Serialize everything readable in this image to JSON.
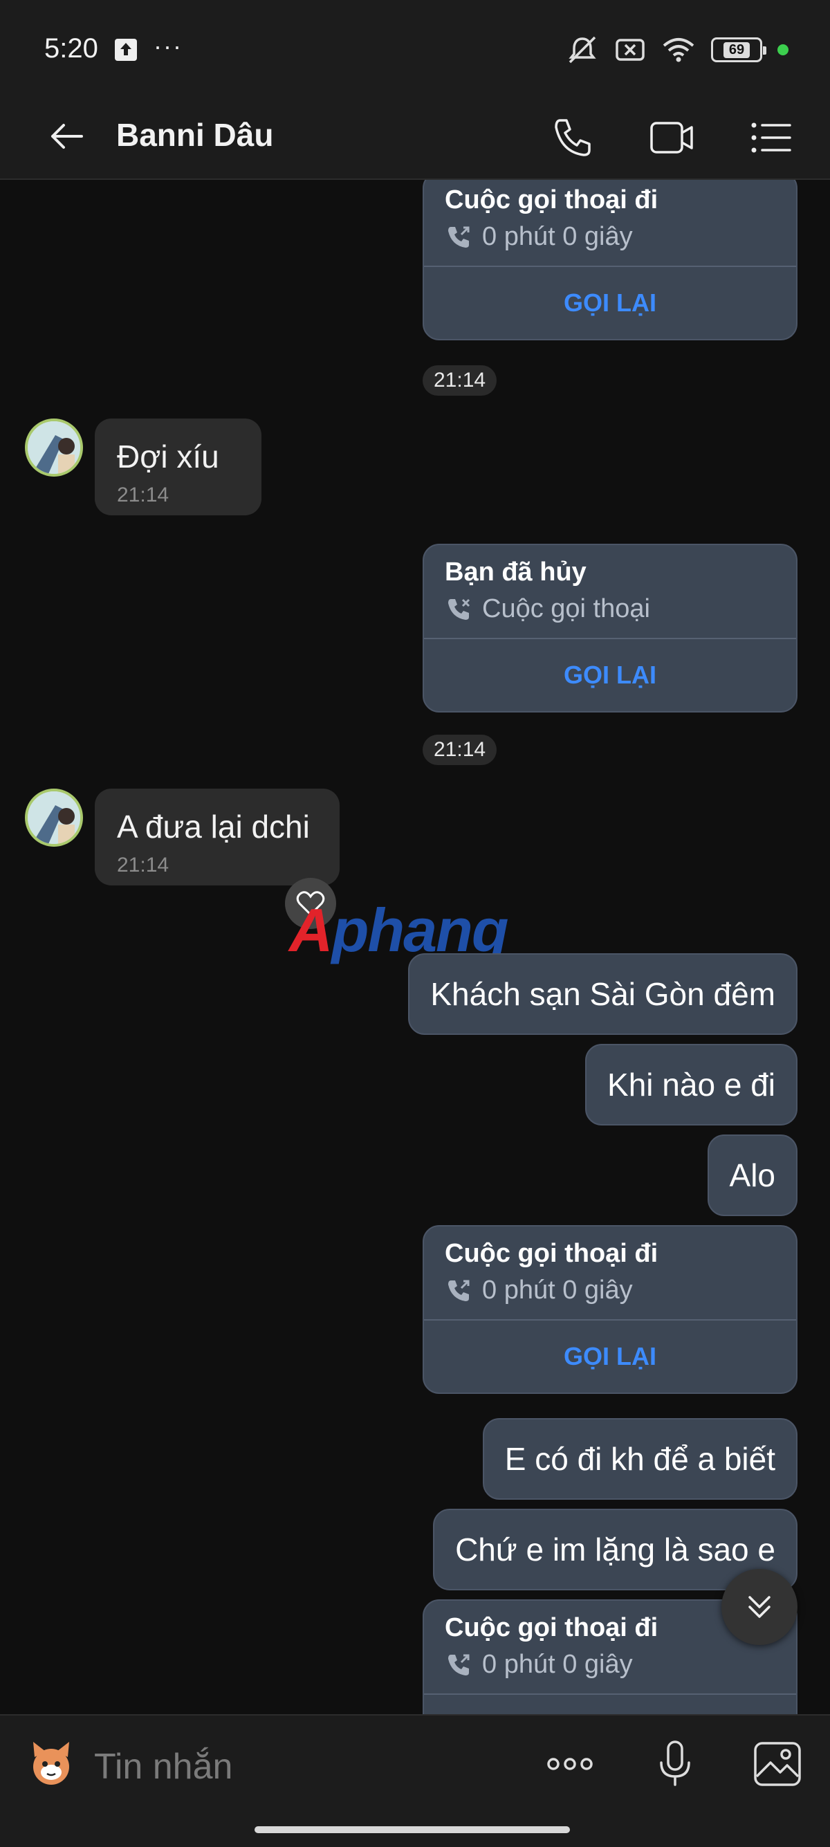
{
  "status_bar": {
    "time": "5:20",
    "battery": "69"
  },
  "header": {
    "contact_name": "Banni Dâu"
  },
  "messages": {
    "call1": {
      "title": "Cuộc gọi thoại đi",
      "detail": "0 phút 0 giây",
      "action": "GỌI LẠI"
    },
    "time1": "21:14",
    "in1": {
      "text": "Đợi xíu",
      "time": "21:14"
    },
    "call2": {
      "title": "Bạn đã hủy",
      "detail": "Cuộc gọi thoại",
      "action": "GỌI LẠI"
    },
    "time2": "21:14",
    "in2": {
      "text": "A đưa lại dchi",
      "time": "21:14"
    },
    "out1": "Khách sạn Sài Gòn đêm",
    "out2": "Khi nào e đi",
    "out3": "Alo",
    "call3": {
      "title": "Cuộc gọi thoại đi",
      "detail": "0 phút 0 giây",
      "action": "GỌI LẠI"
    },
    "out4": "E có đi kh để a biết",
    "out5": "Chứ e im lặng là sao e",
    "call4": {
      "title": "Cuộc gọi thoại đi",
      "detail": "0 phút 0 giây"
    }
  },
  "watermark": {
    "part1": "A",
    "part2": "phang"
  },
  "input": {
    "placeholder": "Tin nhắn"
  },
  "colors": {
    "accent": "#3d8bfd",
    "bubble_out": "#3c4654",
    "bubble_in": "#2c2c2c",
    "background": "#0f0f0f"
  },
  "icons": [
    "back-arrow-icon",
    "phone-icon",
    "video-call-icon",
    "menu-icon",
    "phone-outgoing-icon",
    "phone-missed-icon",
    "heart-icon",
    "chevron-double-down-icon",
    "sticker-icon",
    "more-icon",
    "microphone-icon",
    "image-icon"
  ]
}
